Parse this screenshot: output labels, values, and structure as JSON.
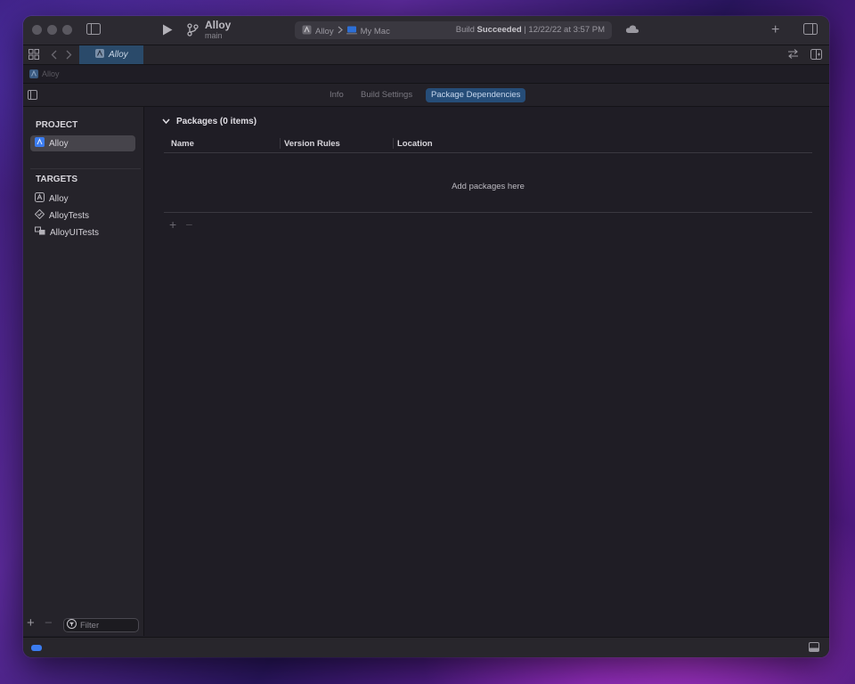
{
  "window": {
    "title": "Alloy",
    "branch": "main"
  },
  "activity": {
    "scheme": "Alloy",
    "destination": "My Mac",
    "status_prefix": "Build",
    "status_bold": "Succeeded",
    "status_suffix": "| 12/22/22 at 3:57 PM"
  },
  "tabbar": {
    "active_tab": "Alloy"
  },
  "jumpbar": {
    "path": "Alloy"
  },
  "editor_tabs": [
    {
      "label": "Info"
    },
    {
      "label": "Build Settings"
    },
    {
      "label": "Package Dependencies"
    }
  ],
  "sidebar": {
    "project_header": "PROJECT",
    "project_item": "Alloy",
    "targets_header": "TARGETS",
    "targets": [
      {
        "label": "Alloy",
        "icon": "app-icon"
      },
      {
        "label": "AlloyTests",
        "icon": "test-diamond-icon"
      },
      {
        "label": "AlloyUITests",
        "icon": "ui-test-icon"
      }
    ],
    "filter_placeholder": "Filter"
  },
  "main": {
    "packages_title": "Packages (0 items)",
    "columns": [
      "Name",
      "Version Rules",
      "Location"
    ],
    "empty_message": "Add packages here"
  },
  "colors": {
    "accent": "#3b7cf0",
    "selected_tab": "#264d78"
  }
}
